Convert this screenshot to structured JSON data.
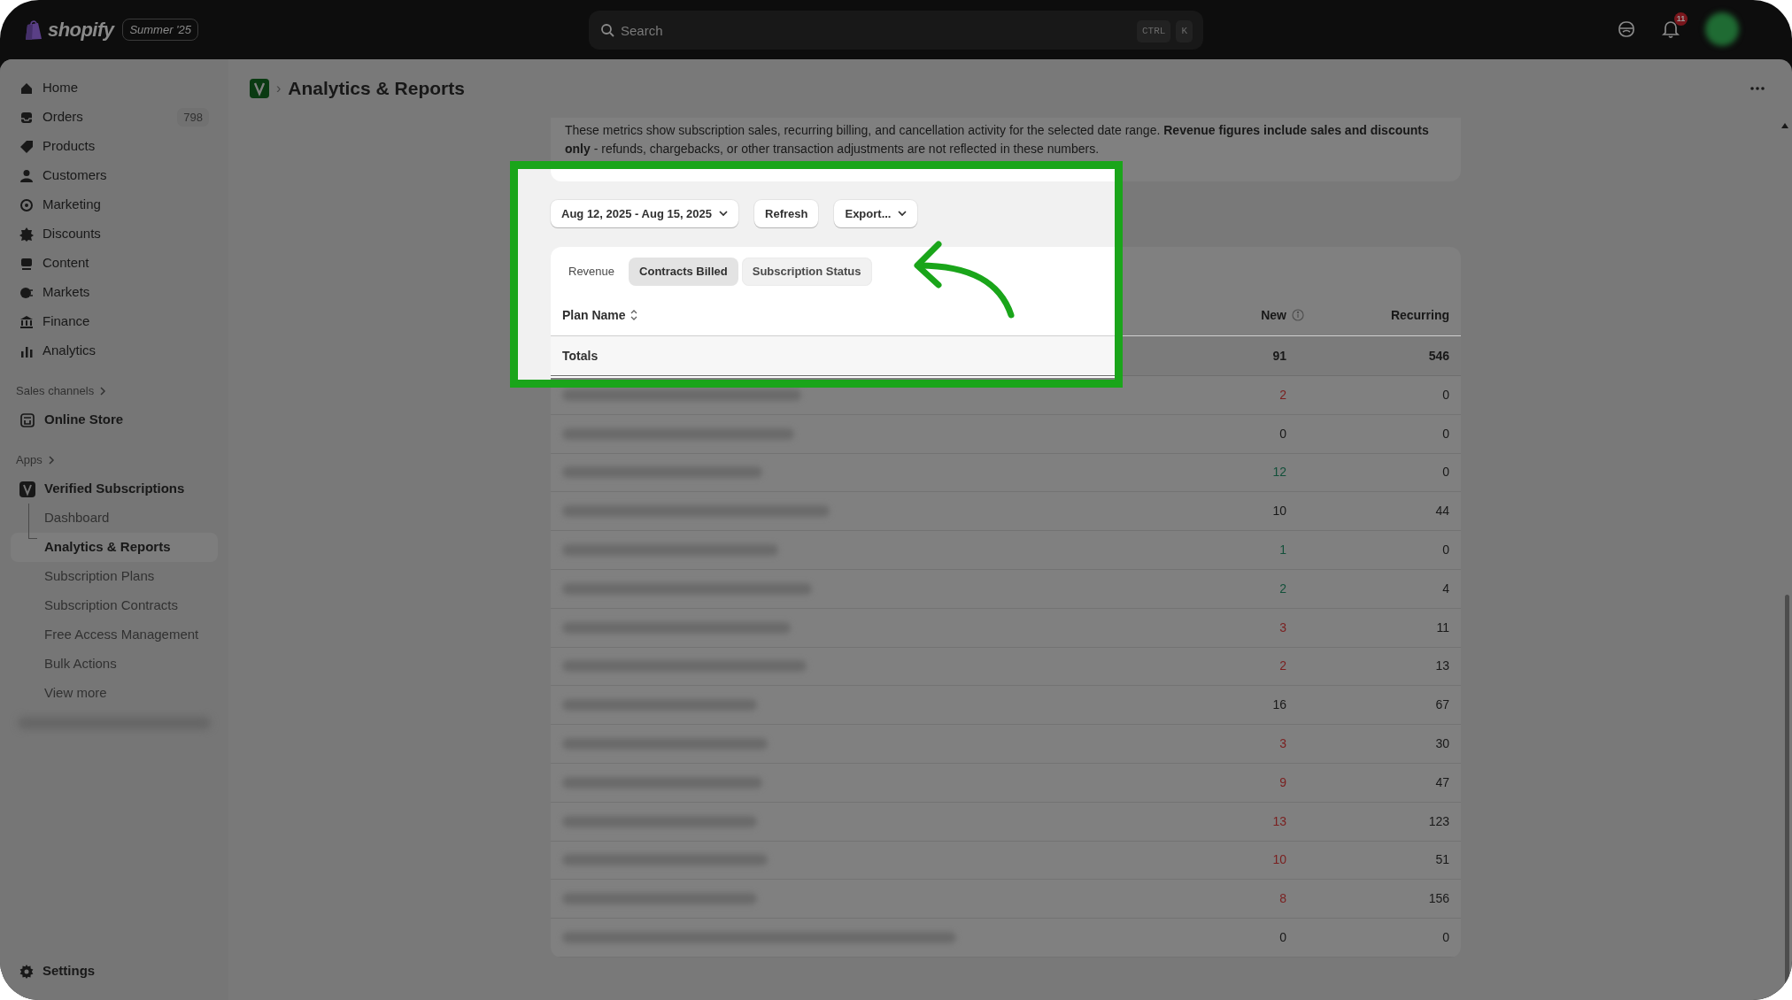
{
  "topbar": {
    "logo": "shopify",
    "edition_badge": "Summer '25",
    "search": {
      "placeholder": "Search",
      "shortcut": [
        "CTRL",
        "K"
      ]
    },
    "notification_count": "11"
  },
  "sidebar": {
    "items": [
      {
        "label": "Home"
      },
      {
        "label": "Orders",
        "badge": "798"
      },
      {
        "label": "Products"
      },
      {
        "label": "Customers"
      },
      {
        "label": "Marketing"
      },
      {
        "label": "Discounts"
      },
      {
        "label": "Content"
      },
      {
        "label": "Markets"
      },
      {
        "label": "Finance"
      },
      {
        "label": "Analytics"
      }
    ],
    "sections": [
      {
        "heading": "Sales channels",
        "items": [
          {
            "label": "Online Store"
          }
        ]
      },
      {
        "heading": "Apps",
        "items": [
          {
            "label": "Verified Subscriptions",
            "children": [
              {
                "label": "Dashboard",
                "selected": false
              },
              {
                "label": "Analytics & Reports",
                "selected": true
              },
              {
                "label": "Subscription Plans",
                "selected": false
              },
              {
                "label": "Subscription Contracts",
                "selected": false
              },
              {
                "label": "Free Access Management",
                "selected": false
              },
              {
                "label": "Bulk Actions",
                "selected": false
              },
              {
                "label": "View more",
                "selected": false
              }
            ]
          }
        ]
      }
    ],
    "footer": {
      "label": "Settings"
    }
  },
  "page_header": {
    "separator": "›",
    "title": "Analytics & Reports"
  },
  "info_text": "These metrics show subscription sales, recurring billing, and cancellation activity for the selected date range. **Revenue figures include sales and discounts only** - refunds, chargebacks, or other transaction adjustments are not reflected in these numbers.",
  "controls": {
    "date_range": "Aug 12, 2025 - Aug 15, 2025",
    "refresh": "Refresh",
    "export": "Export..."
  },
  "tabs": [
    {
      "label": "Revenue",
      "selected": false,
      "hovered": false
    },
    {
      "label": "Contracts Billed",
      "selected": true,
      "hovered": false
    },
    {
      "label": "Subscription Status",
      "selected": false,
      "hovered": true
    }
  ],
  "table": {
    "columns": [
      "Plan Name",
      "New",
      "Recurring"
    ],
    "totals": {
      "label": "Totals",
      "new": "91",
      "recurring": "546"
    },
    "rows": [
      {
        "new": "2",
        "color": "#7a1f1f",
        "recurring": "0"
      },
      {
        "new": "0",
        "color": "#181818",
        "recurring": "0"
      },
      {
        "new": "12",
        "color": "#13503a",
        "recurring": "0"
      },
      {
        "new": "10",
        "color": "#181818",
        "recurring": "44"
      },
      {
        "new": "1",
        "color": "#13503a",
        "recurring": "0"
      },
      {
        "new": "2",
        "color": "#13503a",
        "recurring": "4"
      },
      {
        "new": "3",
        "color": "#7a1f1f",
        "recurring": "11"
      },
      {
        "new": "2",
        "color": "#7a1f1f",
        "recurring": "13"
      },
      {
        "new": "16",
        "color": "#181818",
        "recurring": "67"
      },
      {
        "new": "3",
        "color": "#7a1f1f",
        "recurring": "30"
      },
      {
        "new": "9",
        "color": "#7a1f1f",
        "recurring": "47"
      },
      {
        "new": "13",
        "color": "#7a1f1f",
        "recurring": "123"
      },
      {
        "new": "10",
        "color": "#7a1f1f",
        "recurring": "51"
      },
      {
        "new": "8",
        "color": "#7a1f1f",
        "recurring": "156"
      },
      {
        "new": "0",
        "color": "#181818",
        "recurring": "0"
      }
    ]
  }
}
